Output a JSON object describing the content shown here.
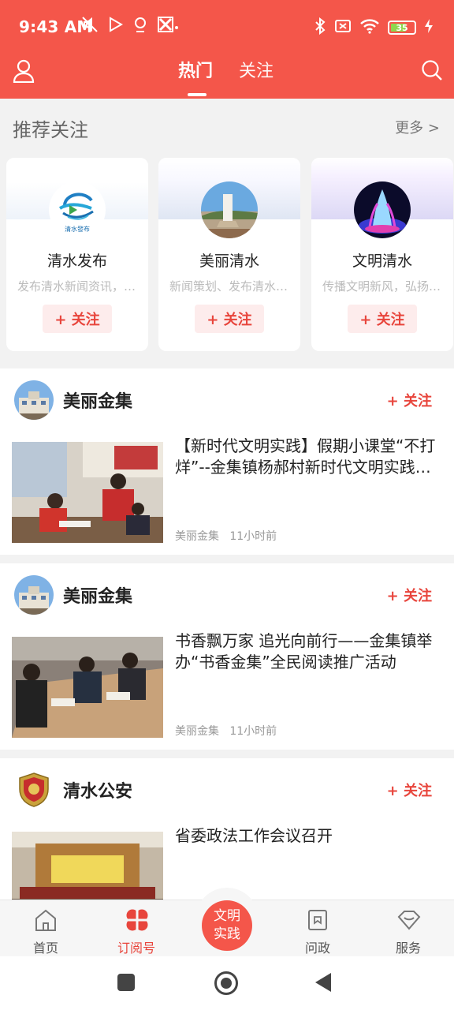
{
  "status_bar": {
    "time": "9:43 AM",
    "battery": "35"
  },
  "nav": {
    "tabs": [
      {
        "label": "热门"
      },
      {
        "label": "关注"
      }
    ]
  },
  "recommend": {
    "title": "推荐关注",
    "more": "更多 >",
    "cards": [
      {
        "name": "清水发布",
        "desc": "发布清水新闻资讯，传播正能量",
        "follow": "+ 关注",
        "logo_text": "清水發布"
      },
      {
        "name": "美丽清水",
        "desc": "新闻策划、发布清水资讯",
        "follow": "+ 关注"
      },
      {
        "name": "文明清水",
        "desc": "传播文明新风，弘扬正能量",
        "follow": "+ 关注"
      }
    ]
  },
  "feed": [
    {
      "account": "美丽金集",
      "follow": "+ 关注",
      "title": "【新时代文明实践】假期小课堂“不打烊”--金集镇杨郝村新时代文明实践站开展假期课堂",
      "source": "美丽金集",
      "time": "11小时前"
    },
    {
      "account": "美丽金集",
      "follow": "+ 关注",
      "title": "书香飘万家  追光向前行——金集镇举办“书香金集”全民阅读推广活动",
      "source": "美丽金集",
      "time": "11小时前"
    },
    {
      "account": "清水公安",
      "follow": "+ 关注",
      "title": "省委政法工作会议召开",
      "source": "",
      "time": ""
    }
  ],
  "tabbar": {
    "items": [
      {
        "label": "首页"
      },
      {
        "label": "订阅号"
      },
      {
        "label": "问政"
      },
      {
        "label": "服务"
      }
    ],
    "center_line1": "文明",
    "center_line2": "实践"
  },
  "colors": {
    "brand": "#f4564a",
    "follow_text": "#e8453c",
    "follow_bg": "#fdecec"
  },
  "icons": [
    "user-icon",
    "search-icon",
    "home-icon",
    "subscription-icon",
    "question-icon",
    "service-icon"
  ]
}
